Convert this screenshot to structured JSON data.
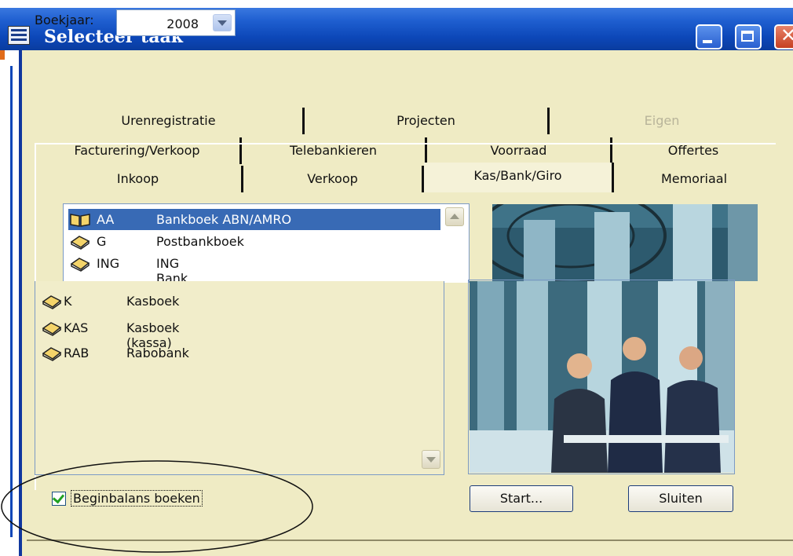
{
  "window": {
    "title": "Selecteer taak"
  },
  "boekjaar": {
    "label": "Boekjaar:",
    "value": "2008"
  },
  "tabs": {
    "row1": [
      {
        "label": "Urenregistratie",
        "disabled": false
      },
      {
        "label": "Projecten",
        "disabled": false
      },
      {
        "label": "Eigen",
        "disabled": true
      }
    ],
    "row2": [
      {
        "label": "Facturering/Verkoop"
      },
      {
        "label": "Telebankieren"
      },
      {
        "label": "Voorraad"
      },
      {
        "label": "Offertes"
      }
    ],
    "row3": [
      {
        "label": "Inkoop"
      },
      {
        "label": "Verkoop"
      },
      {
        "label": "Kas/Bank/Giro",
        "active": true
      },
      {
        "label": "Memoriaal"
      }
    ]
  },
  "journals": [
    {
      "code": "AA",
      "name": "Bankboek ABN/AMRO",
      "selected": true,
      "icon": "open-book-icon"
    },
    {
      "code": "G",
      "name": "Postbankboek",
      "icon": "book-icon"
    },
    {
      "code": "ING",
      "name": "ING Bank",
      "icon": "book-icon"
    },
    {
      "code": "K",
      "name": "Kasboek",
      "icon": "book-icon"
    },
    {
      "code": "KAS",
      "name": "Kasboek (kassa)",
      "icon": "book-icon"
    },
    {
      "code": "RAB",
      "name": "Rabobank",
      "icon": "book-icon"
    }
  ],
  "checkbox": {
    "label": "Beginbalans boeken",
    "checked": true
  },
  "buttons": {
    "start": "Start...",
    "close": "Sluiten"
  },
  "colors": {
    "titlebar": "#0c47b8",
    "dialog": "#efebc4",
    "selection": "#386ab5"
  }
}
